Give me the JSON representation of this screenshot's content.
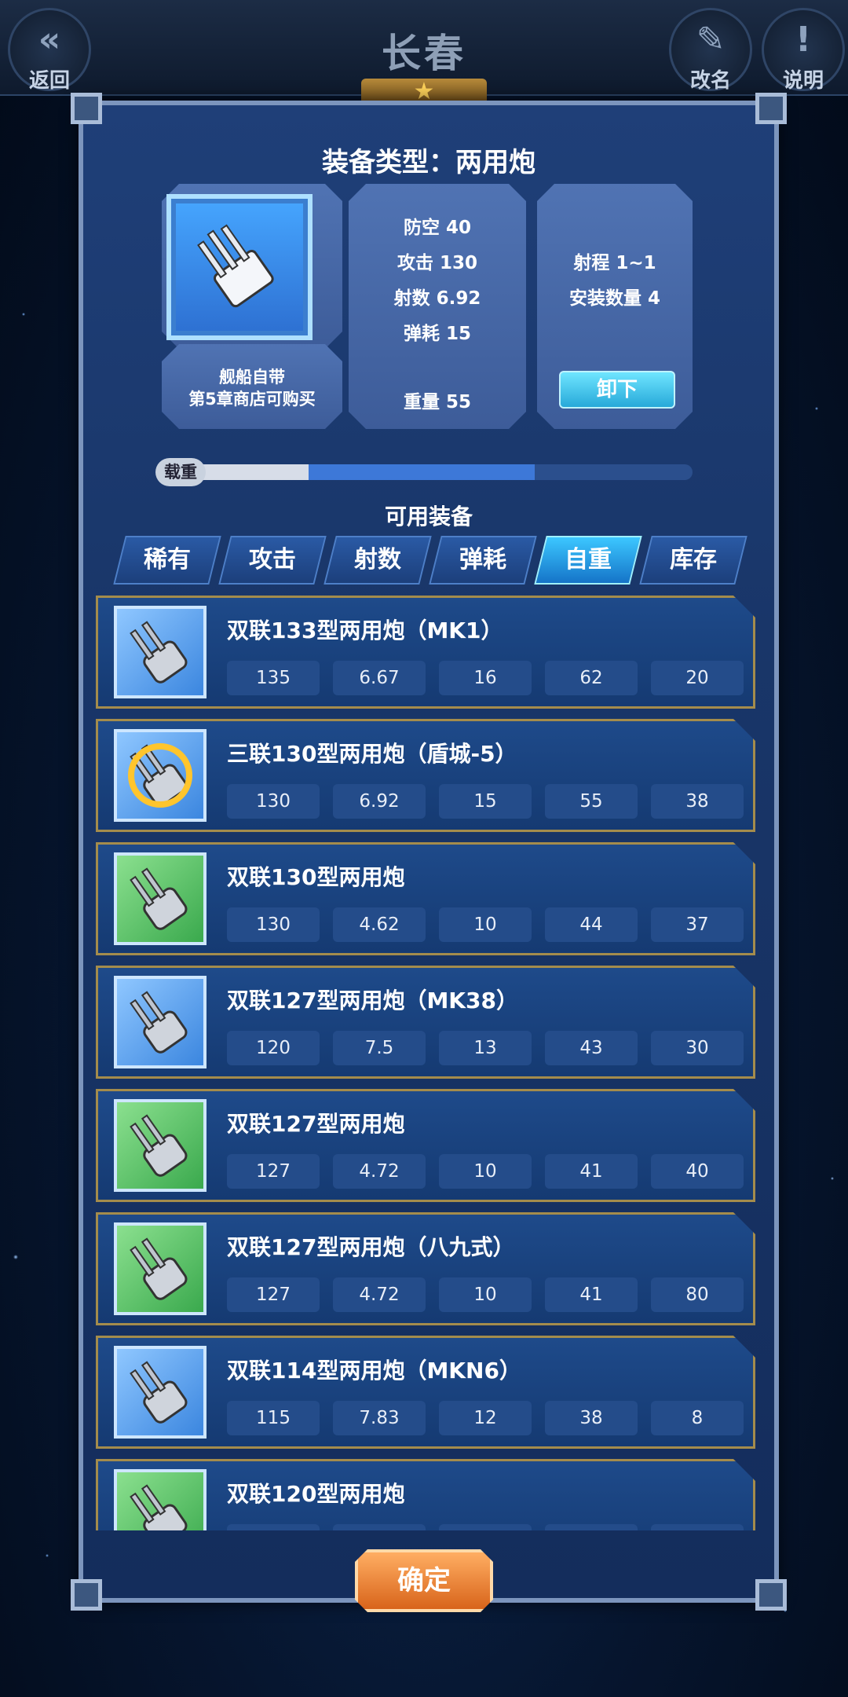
{
  "header": {
    "title": "长春",
    "back_label": "返回",
    "rename_label": "改名",
    "help_label": "说明"
  },
  "panel": {
    "title": "装备类型：两用炮",
    "source_line1": "舰船自带",
    "source_line2": "第5章商店可购买",
    "stats": {
      "anti_air": "防空 40",
      "attack": "攻击 130",
      "rate": "射数 6.92",
      "ammo": "弹耗 15",
      "weight": "重量 55",
      "range": "射程 1~1",
      "install": "安装数量 4"
    },
    "unload_label": "卸下",
    "load_label": "载重",
    "load_used_fraction": 0.27,
    "load_avail_fraction": 0.7,
    "available_title": "可用装备",
    "confirm_label": "确定"
  },
  "tabs": [
    {
      "label": "稀有"
    },
    {
      "label": "攻击"
    },
    {
      "label": "射数"
    },
    {
      "label": "弹耗"
    },
    {
      "label": "自重",
      "active": true
    },
    {
      "label": "库存"
    }
  ],
  "items": [
    {
      "name": "双联133型两用炮（MK1）",
      "rarity": "blue",
      "values": [
        "135",
        "6.67",
        "16",
        "62",
        "20"
      ]
    },
    {
      "name": "三联130型两用炮（盾城-5）",
      "rarity": "gold",
      "values": [
        "130",
        "6.92",
        "15",
        "55",
        "38"
      ]
    },
    {
      "name": "双联130型两用炮",
      "rarity": "green",
      "values": [
        "130",
        "4.62",
        "10",
        "44",
        "37"
      ]
    },
    {
      "name": "双联127型两用炮（MK38）",
      "rarity": "blue",
      "values": [
        "120",
        "7.5",
        "13",
        "43",
        "30"
      ]
    },
    {
      "name": "双联127型两用炮",
      "rarity": "green",
      "values": [
        "127",
        "4.72",
        "10",
        "41",
        "40"
      ]
    },
    {
      "name": "双联127型两用炮（八九式）",
      "rarity": "green",
      "values": [
        "127",
        "4.72",
        "10",
        "41",
        "80"
      ]
    },
    {
      "name": "双联114型两用炮（MKN6）",
      "rarity": "blue",
      "values": [
        "115",
        "7.83",
        "12",
        "38",
        "8"
      ]
    },
    {
      "name": "双联120型两用炮",
      "rarity": "green",
      "values": []
    }
  ]
}
